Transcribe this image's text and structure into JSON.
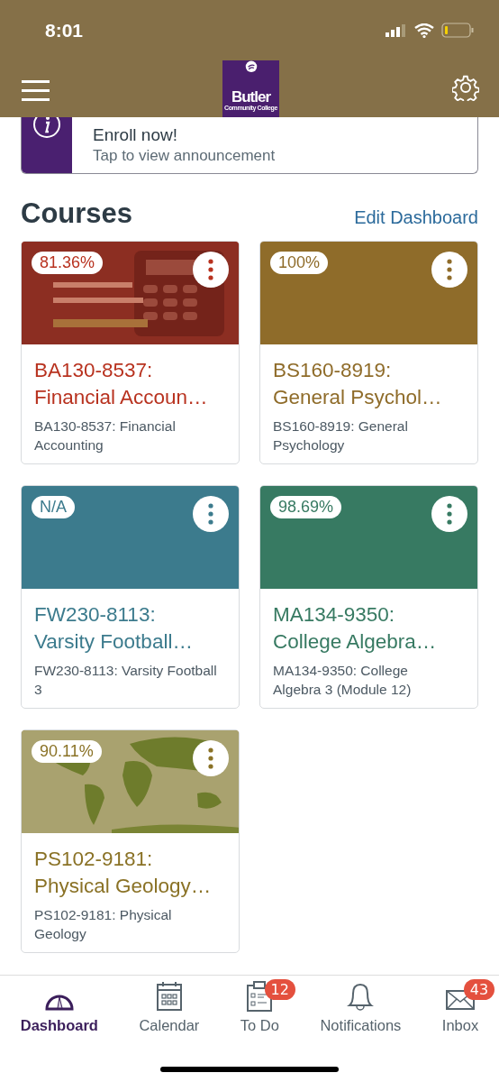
{
  "status_bar": {
    "time": "8:01"
  },
  "nav_bar": {
    "logo": {
      "name": "Butler",
      "subtitle": "Community College"
    }
  },
  "announcement": {
    "title": "Enroll now!",
    "subtitle": "Tap to view announcement"
  },
  "courses_header": {
    "title": "Courses",
    "action": "Edit Dashboard"
  },
  "courses": [
    {
      "grade": "81.36%",
      "color": "#b8321f",
      "kind": "picture",
      "title": "BA130-8537: Financial Accoun…",
      "subtitle": "BA130-8537: Financial Accounting"
    },
    {
      "grade": "100%",
      "color": "#8f6c2a",
      "kind": "plain",
      "title": "BS160-8919: General Psychol…",
      "subtitle": "BS160-8919: General Psychology"
    },
    {
      "grade": "N/A",
      "color": "#3c7b8d",
      "kind": "plain",
      "title": "FW230-8113: Varsity Football…",
      "subtitle": "FW230-8113: Varsity Football 3"
    },
    {
      "grade": "98.69%",
      "color": "#377a62",
      "kind": "plain",
      "title": "MA134-9350: College Algebra…",
      "subtitle": "MA134-9350: College Algebra 3 (Module 12)"
    },
    {
      "grade": "90.11%",
      "color": "#8a7226",
      "kind": "picture",
      "title": "PS102-9181: Physical Geology…",
      "subtitle": "PS102-9181: Physical Geology"
    }
  ],
  "tab_bar": [
    {
      "label": "Dashboard",
      "selected": true
    },
    {
      "label": "Calendar",
      "selected": false
    },
    {
      "label": "To Do",
      "selected": false,
      "badge": "12"
    },
    {
      "label": "Notifications",
      "selected": false
    },
    {
      "label": "Inbox",
      "selected": false,
      "badge": "43"
    }
  ]
}
